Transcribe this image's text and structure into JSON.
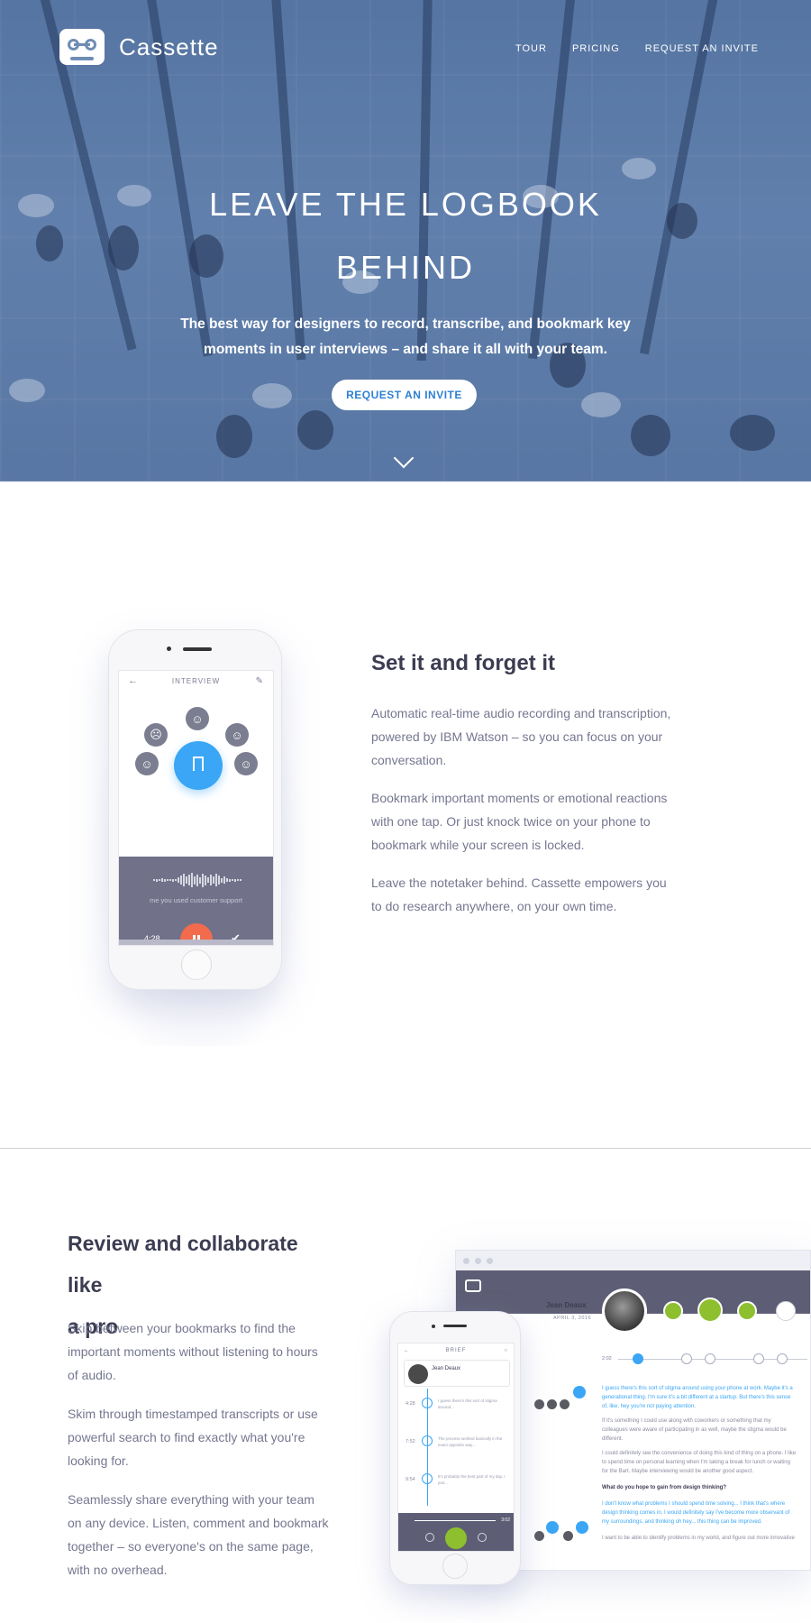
{
  "brand": {
    "name": "Cassette",
    "logo_icon": "cassette-tape-icon"
  },
  "nav": {
    "items": [
      "TOUR",
      "PRICING",
      "REQUEST AN INVITE"
    ]
  },
  "hero": {
    "title_line1": "LEAVE THE LOGBOOK",
    "title_line2": "BEHIND",
    "subtitle": "The best way for designers to record, transcribe, and bookmark key moments in user interviews – and share it all with your team.",
    "cta": "REQUEST AN INVITE",
    "scroll_icon": "chevron-down-icon"
  },
  "section1": {
    "title": "Set it and forget it",
    "paragraphs": [
      "Automatic real-time audio recording and transcription, powered by IBM Watson – so you can focus on your conversation.",
      "Bookmark important moments or emotional reactions with one tap. Or just knock twice on your phone to bookmark while your screen is locked.",
      "Leave the notetaker behind. Cassette empowers you to do research anywhere, on your own time."
    ],
    "phone": {
      "header": "INTERVIEW",
      "caption": "me you used customer support",
      "time": "4:28"
    }
  },
  "section2": {
    "title_line1": "Review and collaborate like",
    "title_line2": "a pro",
    "paragraphs": [
      "Skip between your bookmarks to find the important moments without listening to hours of audio.",
      "Skim through timestamped transcripts or use powerful search to find exactly what you're looking for.",
      "Seamlessly share everything with your team on any device. Listen, comment and bookmark together – so everyone's on the same page, with no overhead."
    ],
    "desktop": {
      "name": "Jean Deaux",
      "date": "APRIL 3, 2016",
      "timeline_start": "2:02",
      "transcript": [
        "I guess there's this sort of stigma around using your phone at work. Maybe it's a",
        "generational thing. I'm sure it's a bit different at a startup. But there's this sense",
        "of, like, hey you're not paying attention.",
        "If it's something I could use along with coworkers or something that my",
        "colleagues were aware of participating in as well, maybe the stigma would be",
        "different.",
        "I could definitely see the convenience of doing this kind of thing on a phone. I like",
        "to spend time on personal learning when I'm taking a break for lunch or waiting",
        "for the Bart. Maybe interviewing would be another good aspect.",
        "What do you hope to gain from design thinking?",
        "I don't know what problems I should spend time solving... I think that's where",
        "design thinking comes in. I would definitely say I've become more observant of",
        "my surroundings, and thinking oh hey... this thing can be improved.",
        "I want to be able to identify problems in my world, and figure out more innovative"
      ]
    },
    "mobile": {
      "header": "BRIEF",
      "name": "Jean Deaux",
      "rows": [
        {
          "time": "4:28",
          "text": "I guess there's this sort of stigma around..."
        },
        {
          "time": "7:52",
          "text": "The process worked basically in the exact opposite way..."
        },
        {
          "time": "9:54",
          "text": "It's probably the best part of my day. I just..."
        }
      ],
      "player_time": "3:02"
    }
  }
}
